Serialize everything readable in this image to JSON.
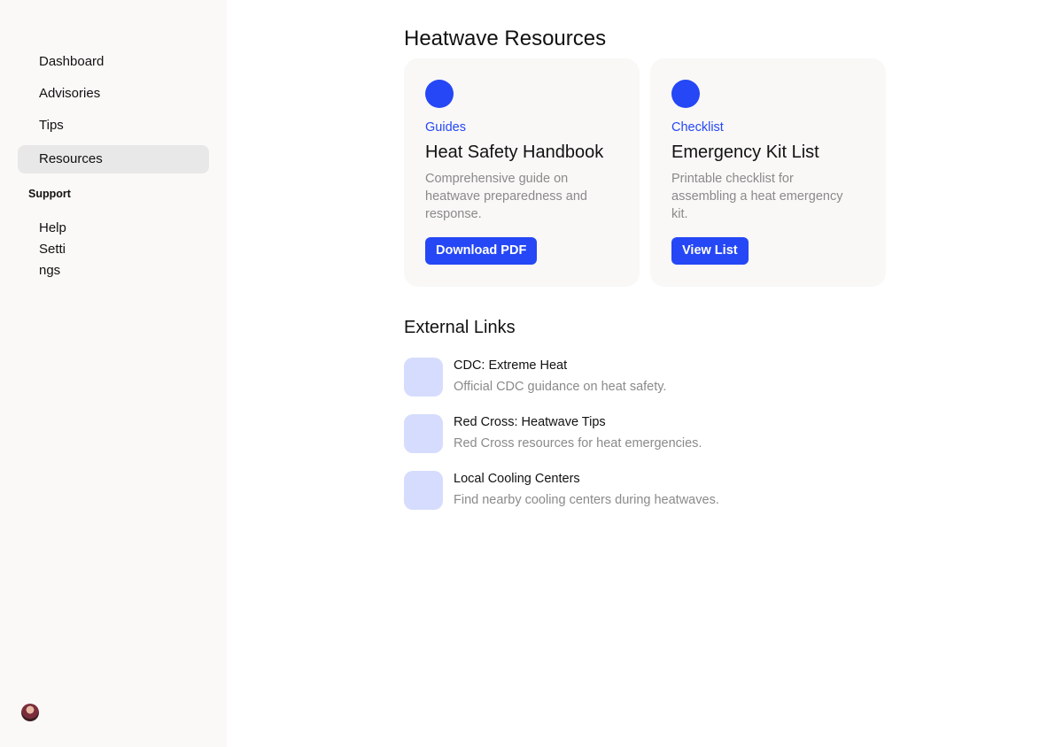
{
  "sidebar": {
    "nav": [
      {
        "label": "Dashboard",
        "active": false
      },
      {
        "label": "Advisories",
        "active": false
      },
      {
        "label": "Tips",
        "active": false
      },
      {
        "label": "Resources",
        "active": true
      }
    ],
    "support_label": "Support",
    "support_items": [
      {
        "label": "Help"
      },
      {
        "label": "Settings"
      }
    ],
    "avatar_icon": "user-avatar"
  },
  "main": {
    "title": "Heatwave Resources",
    "cards": [
      {
        "icon": "circle-icon",
        "category": "Guides",
        "title": "Heat Safety Handbook",
        "description": "Comprehensive guide on heatwave preparedness and response.",
        "button": "Download PDF"
      },
      {
        "icon": "circle-icon",
        "category": "Checklist",
        "title": "Emergency Kit List",
        "description": "Printable checklist for assembling a heat emergency kit.",
        "button": "View List"
      }
    ],
    "links_title": "External Links",
    "links": [
      {
        "title": "CDC: Extreme Heat",
        "description": "Official CDC guidance on heat safety."
      },
      {
        "title": "Red Cross: Heatwave Tips",
        "description": "Red Cross resources for heat emergencies."
      },
      {
        "title": "Local Cooling Centers",
        "description": "Find nearby cooling centers during heatwaves."
      }
    ]
  },
  "colors": {
    "accent": "#2547f5",
    "sidebar_bg": "#faf9f7",
    "card_bg": "#f9f8f7",
    "link_icon_bg": "#d6dcfd",
    "muted_text": "#8a8a8a"
  }
}
